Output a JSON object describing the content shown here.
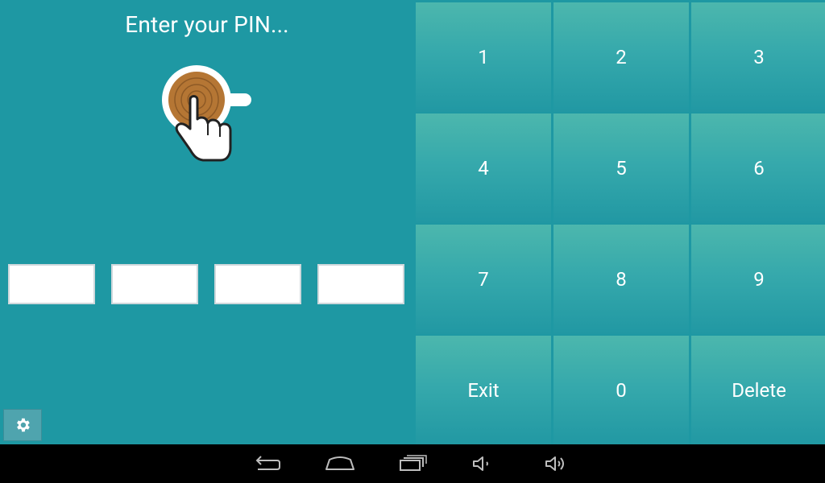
{
  "prompt": {
    "title": "Enter your PIN..."
  },
  "pin": {
    "slots": [
      {
        "name": "pin-digit-1",
        "value": ""
      },
      {
        "name": "pin-digit-2",
        "value": ""
      },
      {
        "name": "pin-digit-3",
        "value": ""
      },
      {
        "name": "pin-digit-4",
        "value": ""
      }
    ]
  },
  "keypad": {
    "keys": [
      "1",
      "2",
      "3",
      "4",
      "5",
      "6",
      "7",
      "8",
      "9",
      "Exit",
      "0",
      "Delete"
    ]
  },
  "settings": {
    "icon": "gear-icon"
  },
  "navbar": {
    "icons": [
      "back-icon",
      "home-icon",
      "recent-apps-icon",
      "volume-down-icon",
      "volume-up-icon"
    ]
  },
  "colors": {
    "background": "#1e98a3",
    "key_top": "#4cb7ad",
    "key_bottom": "#2198a3",
    "coffee": "#b57634",
    "navbar": "#000000"
  }
}
